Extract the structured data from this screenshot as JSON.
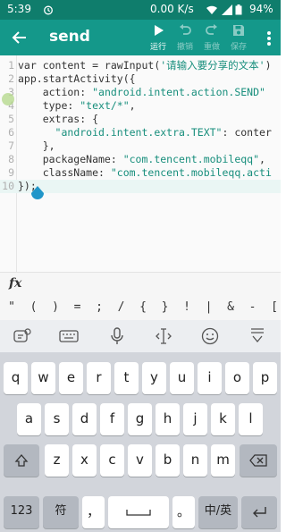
{
  "status_bar": {
    "time": "5:39",
    "network_speed": "0.00 K/s",
    "battery": "94%",
    "icons": [
      "alarm-icon",
      "wifi-icon",
      "signal-icon",
      "battery-icon"
    ]
  },
  "toolbar": {
    "title": "send",
    "actions": [
      {
        "label": "运行",
        "icon": "play-icon",
        "enabled": true
      },
      {
        "label": "撤销",
        "icon": "undo-icon",
        "enabled": false
      },
      {
        "label": "重做",
        "icon": "redo-icon",
        "enabled": false
      },
      {
        "label": "保存",
        "icon": "save-icon",
        "enabled": false
      }
    ]
  },
  "editor": {
    "current_line": 10,
    "lines": [
      {
        "num": "1",
        "code": "var content = rawInput('请输入要分享的文本')"
      },
      {
        "num": "2",
        "code": "app.startActivity({"
      },
      {
        "num": "3",
        "code": "    action: \"android.intent.action.SEND\""
      },
      {
        "num": "4",
        "code": "    type: \"text/*\","
      },
      {
        "num": "5",
        "code": "    extras: {"
      },
      {
        "num": "6",
        "code": "      \"android.intent.extra.TEXT\": conter"
      },
      {
        "num": "7",
        "code": "    },"
      },
      {
        "num": "8",
        "code": "    packageName: \"com.tencent.mobileqq\","
      },
      {
        "num": "9",
        "code": "    className: \"com.tencent.mobileqq.acti"
      },
      {
        "num": "10",
        "code": "});"
      }
    ]
  },
  "fx_panel": {
    "label": "fx",
    "symbols": [
      "\"",
      "(",
      ")",
      "=",
      ";",
      "/",
      "{",
      "}",
      "!",
      "|",
      "&",
      "-",
      "["
    ]
  },
  "keyboard": {
    "row1": [
      "q",
      "w",
      "e",
      "r",
      "t",
      "y",
      "u",
      "i",
      "o",
      "p"
    ],
    "row2": [
      "a",
      "s",
      "d",
      "f",
      "g",
      "h",
      "j",
      "k",
      "l"
    ],
    "row3": [
      "z",
      "x",
      "c",
      "v",
      "b",
      "n",
      "m"
    ],
    "num_key": "123",
    "symbol_key": "符",
    "comma_key": "，",
    "period_key": "。",
    "lang_key": "中/英",
    "colors": {
      "accent": "#14988a",
      "status": "#0f7d6c",
      "key_bg": "#ffffff",
      "board_bg": "#d2d5db"
    }
  }
}
